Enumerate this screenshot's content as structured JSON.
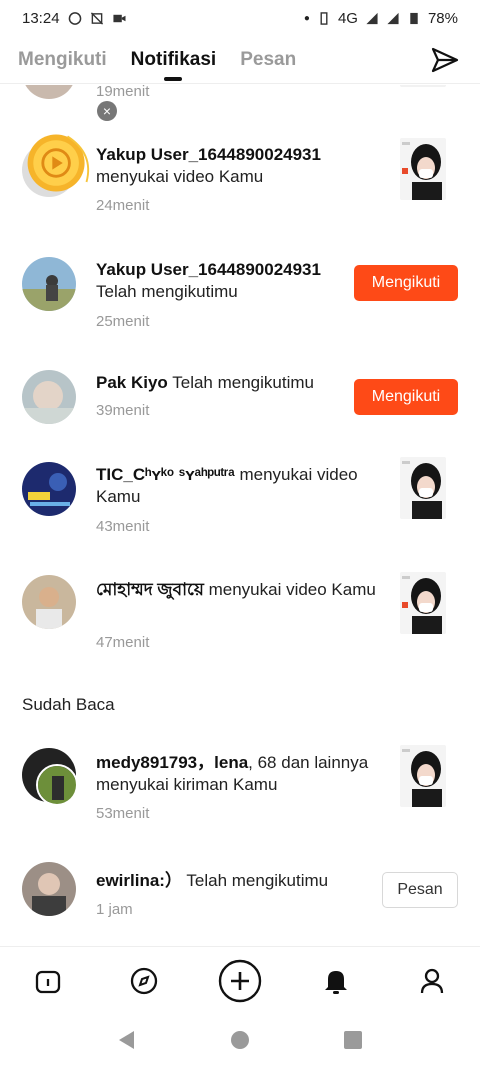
{
  "status": {
    "time": "13:24",
    "network": "4G",
    "battery": "78%"
  },
  "tabs": [
    {
      "label": "Mengikuti"
    },
    {
      "label": "Notifikasi"
    },
    {
      "label": "Pesan"
    }
  ],
  "notifications": [
    {
      "time": "19menit"
    },
    {
      "user": "Yakup User_1644890024931",
      "text": "menyukai video Kamu",
      "time": "24menit"
    },
    {
      "user": "Yakup User_1644890024931",
      "text": "Telah mengikutimu",
      "time": "25menit",
      "button": "Mengikuti"
    },
    {
      "user": "Pak Kiyo",
      "text": "Telah mengikutimu",
      "time": "39menit",
      "button": "Mengikuti"
    },
    {
      "user": "TIC_Cʰʏᵏᵒ ˢʏᵃʰᵖᵘᵗʳᵃ",
      "text": "menyukai video Kamu",
      "time": "43menit"
    },
    {
      "user": "মোহাম্মদ জুবায়ে",
      "text": "menyukai video Kamu",
      "time": "47menit"
    }
  ],
  "read_section": {
    "title": "Sudah Baca",
    "items": [
      {
        "user": "medy891793，lena",
        "text": ", 68 dan lainnya menyukai kiriman Kamu",
        "time": "53menit"
      },
      {
        "user": "ewirlina:）",
        "text": "Telah mengikutimu",
        "time": "1 jam",
        "button": "Pesan"
      }
    ]
  },
  "bottom_nav": [
    "home-icon",
    "discover-icon",
    "create-icon",
    "notification-icon",
    "profile-icon"
  ],
  "colors": {
    "accent": "#fe4a17",
    "muted": "#9a9a9a"
  }
}
